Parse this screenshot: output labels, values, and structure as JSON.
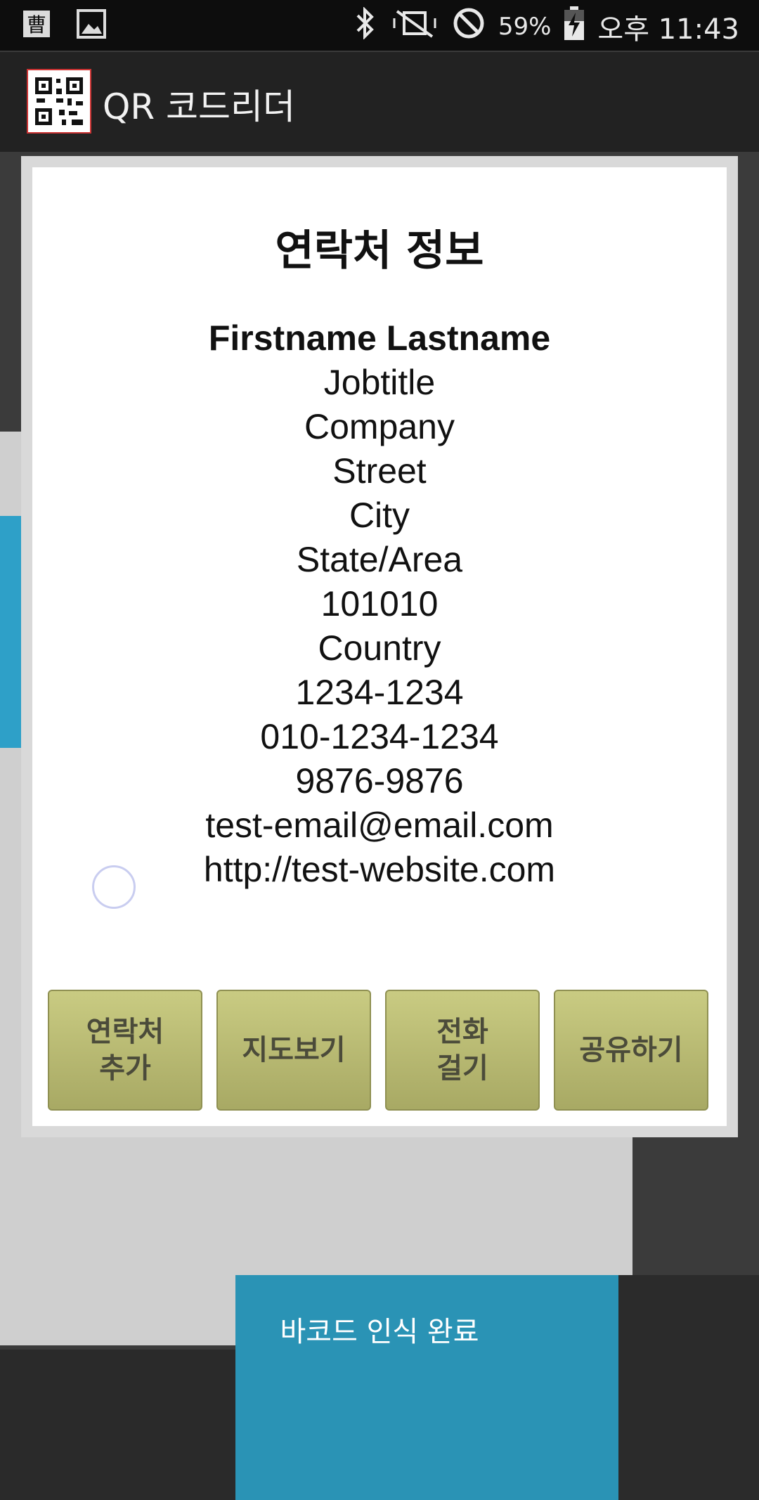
{
  "status_bar": {
    "left_icons": [
      "calendar-icon",
      "image-icon"
    ],
    "battery_percent": "59%",
    "time": "오후 11:43"
  },
  "app_bar": {
    "title": "QR 코드리더"
  },
  "dialog": {
    "title": "연락처 정보",
    "name": "Firstname Lastname",
    "lines": [
      "Jobtitle",
      "Company",
      "Street",
      "City",
      "State/Area",
      "101010",
      "Country",
      "1234-1234",
      "010-1234-1234",
      "9876-9876",
      "test-email@email.com",
      "http://test-website.com"
    ],
    "buttons": {
      "add_contact": "연락처\n추가",
      "map": "지도보기",
      "call": "전화\n걸기",
      "share": "공유하기"
    }
  },
  "toast": "바코드 인식 완료",
  "colors": {
    "button_top": "#c9cb82",
    "button_bottom": "#a8a964",
    "status_bar_bg": "#0d0d0d",
    "app_bar_bg": "#222222"
  }
}
